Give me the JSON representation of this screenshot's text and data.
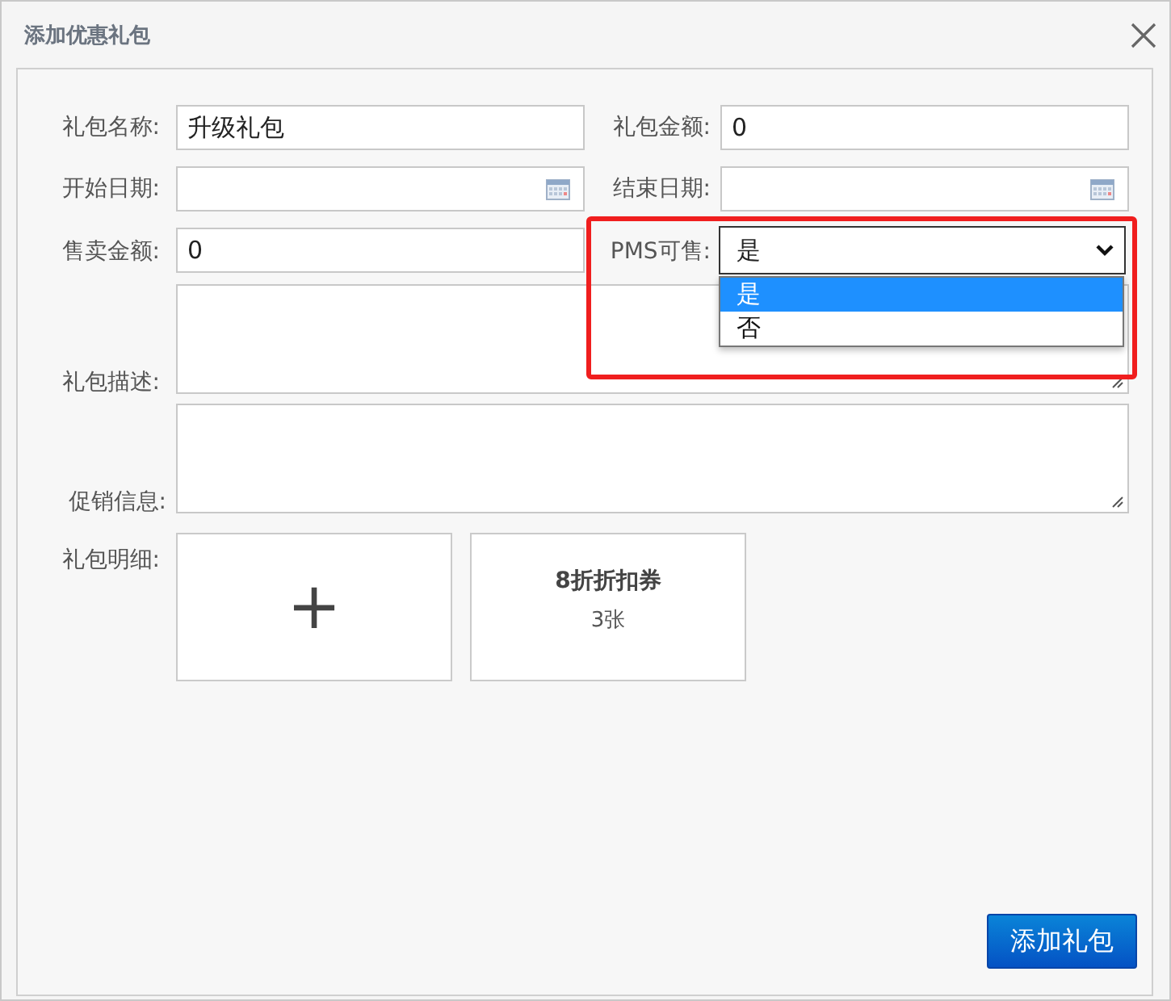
{
  "dialog": {
    "title": "添加优惠礼包"
  },
  "fields": [
    {
      "kind": "text",
      "label": "礼包名称:",
      "value": "升级礼包"
    },
    {
      "kind": "text",
      "label": "礼包金额:",
      "value": "0"
    },
    {
      "kind": "date",
      "label": "开始日期:"
    },
    {
      "kind": "date",
      "label": "结束日期:"
    },
    {
      "kind": "text",
      "label": "售卖金额:",
      "value": "0"
    },
    {
      "kind": "select",
      "label": "PMS可售:",
      "value": "是",
      "expanded": true,
      "highlighted": true,
      "options": [
        {
          "label": "是",
          "selected": true
        },
        {
          "label": "否",
          "selected": false
        }
      ]
    },
    {
      "kind": "textarea",
      "label": "礼包描述:"
    },
    {
      "kind": "textarea",
      "label": "促销信息:"
    }
  ],
  "details": {
    "label": "礼包明细:",
    "items": [
      {
        "kind": "add",
        "symbol": "+"
      },
      {
        "kind": "coupon",
        "name": "8折折扣券",
        "count": "3张"
      }
    ]
  },
  "submit_button": "添加礼包"
}
